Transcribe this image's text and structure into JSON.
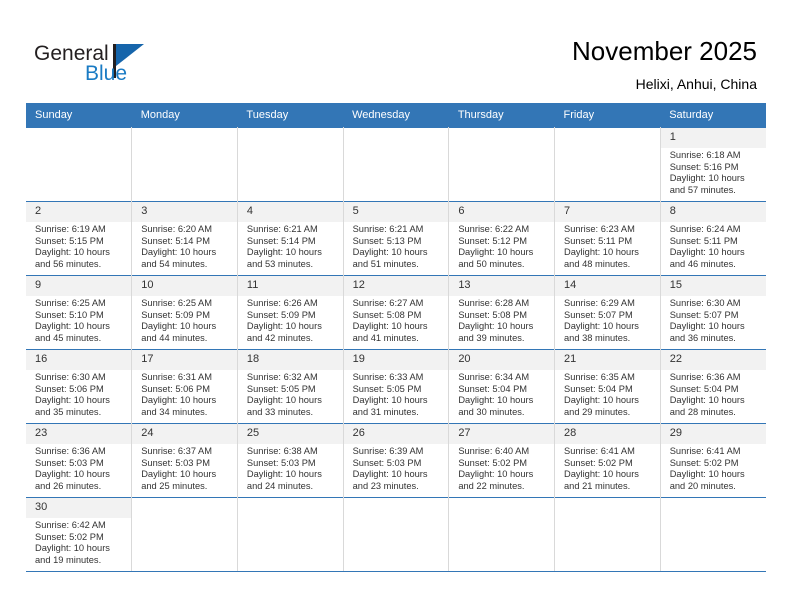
{
  "brand": {
    "name_part1": "General",
    "name_part2": "Blue",
    "flag_icon": "blue-flag-triangle"
  },
  "header": {
    "title": "November 2025",
    "subtitle": "Helixi, Anhui, China"
  },
  "calendar": {
    "weekday_headers": [
      "Sunday",
      "Monday",
      "Tuesday",
      "Wednesday",
      "Thursday",
      "Friday",
      "Saturday"
    ],
    "accent_color": "#3376b6",
    "daynum_band_color": "#f2f2f2",
    "weeks": [
      [
        {
          "blank": true
        },
        {
          "blank": true
        },
        {
          "blank": true
        },
        {
          "blank": true
        },
        {
          "blank": true
        },
        {
          "blank": true
        },
        {
          "day": "1",
          "sunrise": "Sunrise: 6:18 AM",
          "sunset": "Sunset: 5:16 PM",
          "daylight_line1": "Daylight: 10 hours",
          "daylight_line2": "and 57 minutes."
        }
      ],
      [
        {
          "day": "2",
          "sunrise": "Sunrise: 6:19 AM",
          "sunset": "Sunset: 5:15 PM",
          "daylight_line1": "Daylight: 10 hours",
          "daylight_line2": "and 56 minutes."
        },
        {
          "day": "3",
          "sunrise": "Sunrise: 6:20 AM",
          "sunset": "Sunset: 5:14 PM",
          "daylight_line1": "Daylight: 10 hours",
          "daylight_line2": "and 54 minutes."
        },
        {
          "day": "4",
          "sunrise": "Sunrise: 6:21 AM",
          "sunset": "Sunset: 5:14 PM",
          "daylight_line1": "Daylight: 10 hours",
          "daylight_line2": "and 53 minutes."
        },
        {
          "day": "5",
          "sunrise": "Sunrise: 6:21 AM",
          "sunset": "Sunset: 5:13 PM",
          "daylight_line1": "Daylight: 10 hours",
          "daylight_line2": "and 51 minutes."
        },
        {
          "day": "6",
          "sunrise": "Sunrise: 6:22 AM",
          "sunset": "Sunset: 5:12 PM",
          "daylight_line1": "Daylight: 10 hours",
          "daylight_line2": "and 50 minutes."
        },
        {
          "day": "7",
          "sunrise": "Sunrise: 6:23 AM",
          "sunset": "Sunset: 5:11 PM",
          "daylight_line1": "Daylight: 10 hours",
          "daylight_line2": "and 48 minutes."
        },
        {
          "day": "8",
          "sunrise": "Sunrise: 6:24 AM",
          "sunset": "Sunset: 5:11 PM",
          "daylight_line1": "Daylight: 10 hours",
          "daylight_line2": "and 46 minutes."
        }
      ],
      [
        {
          "day": "9",
          "sunrise": "Sunrise: 6:25 AM",
          "sunset": "Sunset: 5:10 PM",
          "daylight_line1": "Daylight: 10 hours",
          "daylight_line2": "and 45 minutes."
        },
        {
          "day": "10",
          "sunrise": "Sunrise: 6:25 AM",
          "sunset": "Sunset: 5:09 PM",
          "daylight_line1": "Daylight: 10 hours",
          "daylight_line2": "and 44 minutes."
        },
        {
          "day": "11",
          "sunrise": "Sunrise: 6:26 AM",
          "sunset": "Sunset: 5:09 PM",
          "daylight_line1": "Daylight: 10 hours",
          "daylight_line2": "and 42 minutes."
        },
        {
          "day": "12",
          "sunrise": "Sunrise: 6:27 AM",
          "sunset": "Sunset: 5:08 PM",
          "daylight_line1": "Daylight: 10 hours",
          "daylight_line2": "and 41 minutes."
        },
        {
          "day": "13",
          "sunrise": "Sunrise: 6:28 AM",
          "sunset": "Sunset: 5:08 PM",
          "daylight_line1": "Daylight: 10 hours",
          "daylight_line2": "and 39 minutes."
        },
        {
          "day": "14",
          "sunrise": "Sunrise: 6:29 AM",
          "sunset": "Sunset: 5:07 PM",
          "daylight_line1": "Daylight: 10 hours",
          "daylight_line2": "and 38 minutes."
        },
        {
          "day": "15",
          "sunrise": "Sunrise: 6:30 AM",
          "sunset": "Sunset: 5:07 PM",
          "daylight_line1": "Daylight: 10 hours",
          "daylight_line2": "and 36 minutes."
        }
      ],
      [
        {
          "day": "16",
          "sunrise": "Sunrise: 6:30 AM",
          "sunset": "Sunset: 5:06 PM",
          "daylight_line1": "Daylight: 10 hours",
          "daylight_line2": "and 35 minutes."
        },
        {
          "day": "17",
          "sunrise": "Sunrise: 6:31 AM",
          "sunset": "Sunset: 5:06 PM",
          "daylight_line1": "Daylight: 10 hours",
          "daylight_line2": "and 34 minutes."
        },
        {
          "day": "18",
          "sunrise": "Sunrise: 6:32 AM",
          "sunset": "Sunset: 5:05 PM",
          "daylight_line1": "Daylight: 10 hours",
          "daylight_line2": "and 33 minutes."
        },
        {
          "day": "19",
          "sunrise": "Sunrise: 6:33 AM",
          "sunset": "Sunset: 5:05 PM",
          "daylight_line1": "Daylight: 10 hours",
          "daylight_line2": "and 31 minutes."
        },
        {
          "day": "20",
          "sunrise": "Sunrise: 6:34 AM",
          "sunset": "Sunset: 5:04 PM",
          "daylight_line1": "Daylight: 10 hours",
          "daylight_line2": "and 30 minutes."
        },
        {
          "day": "21",
          "sunrise": "Sunrise: 6:35 AM",
          "sunset": "Sunset: 5:04 PM",
          "daylight_line1": "Daylight: 10 hours",
          "daylight_line2": "and 29 minutes."
        },
        {
          "day": "22",
          "sunrise": "Sunrise: 6:36 AM",
          "sunset": "Sunset: 5:04 PM",
          "daylight_line1": "Daylight: 10 hours",
          "daylight_line2": "and 28 minutes."
        }
      ],
      [
        {
          "day": "23",
          "sunrise": "Sunrise: 6:36 AM",
          "sunset": "Sunset: 5:03 PM",
          "daylight_line1": "Daylight: 10 hours",
          "daylight_line2": "and 26 minutes."
        },
        {
          "day": "24",
          "sunrise": "Sunrise: 6:37 AM",
          "sunset": "Sunset: 5:03 PM",
          "daylight_line1": "Daylight: 10 hours",
          "daylight_line2": "and 25 minutes."
        },
        {
          "day": "25",
          "sunrise": "Sunrise: 6:38 AM",
          "sunset": "Sunset: 5:03 PM",
          "daylight_line1": "Daylight: 10 hours",
          "daylight_line2": "and 24 minutes."
        },
        {
          "day": "26",
          "sunrise": "Sunrise: 6:39 AM",
          "sunset": "Sunset: 5:03 PM",
          "daylight_line1": "Daylight: 10 hours",
          "daylight_line2": "and 23 minutes."
        },
        {
          "day": "27",
          "sunrise": "Sunrise: 6:40 AM",
          "sunset": "Sunset: 5:02 PM",
          "daylight_line1": "Daylight: 10 hours",
          "daylight_line2": "and 22 minutes."
        },
        {
          "day": "28",
          "sunrise": "Sunrise: 6:41 AM",
          "sunset": "Sunset: 5:02 PM",
          "daylight_line1": "Daylight: 10 hours",
          "daylight_line2": "and 21 minutes."
        },
        {
          "day": "29",
          "sunrise": "Sunrise: 6:41 AM",
          "sunset": "Sunset: 5:02 PM",
          "daylight_line1": "Daylight: 10 hours",
          "daylight_line2": "and 20 minutes."
        }
      ],
      [
        {
          "day": "30",
          "sunrise": "Sunrise: 6:42 AM",
          "sunset": "Sunset: 5:02 PM",
          "daylight_line1": "Daylight: 10 hours",
          "daylight_line2": "and 19 minutes."
        },
        {
          "blank": true
        },
        {
          "blank": true
        },
        {
          "blank": true
        },
        {
          "blank": true
        },
        {
          "blank": true
        },
        {
          "blank": true
        }
      ]
    ]
  }
}
